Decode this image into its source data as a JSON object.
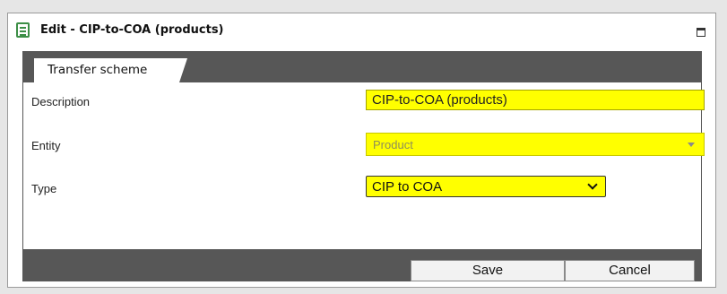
{
  "window": {
    "title": "Edit - CIP-to-COA (products)"
  },
  "tabs": [
    {
      "label": "Transfer scheme",
      "active": true
    }
  ],
  "form": {
    "description": {
      "label": "Description",
      "value": "CIP-to-COA (products)"
    },
    "entity": {
      "label": "Entity",
      "value": "Product",
      "disabled": true
    },
    "type": {
      "label": "Type",
      "value": "CIP to COA"
    }
  },
  "actions": {
    "save_label": "Save",
    "cancel_label": "Cancel"
  },
  "colors": {
    "highlight": "#ffff00",
    "bar": "#575757",
    "app_icon": "#3d8f47"
  },
  "icons": [
    "form-icon",
    "maximize-icon",
    "dropdown-caret-icon",
    "chevron-down-icon"
  ]
}
